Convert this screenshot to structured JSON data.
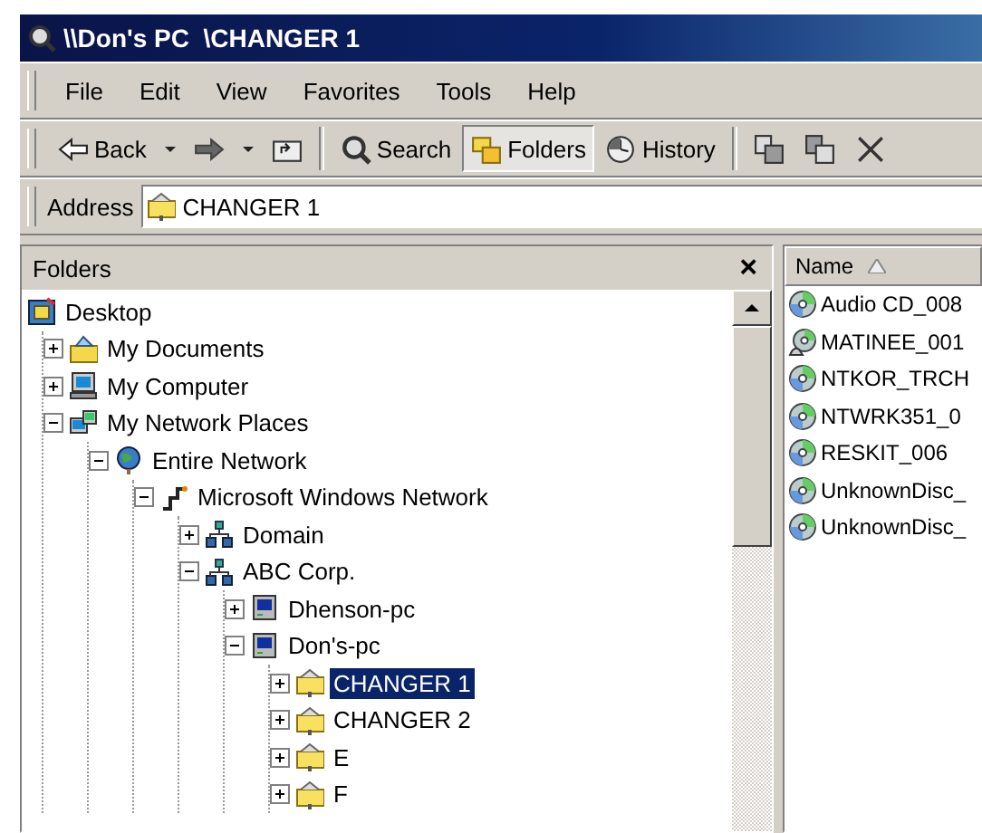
{
  "window": {
    "title": "\\\\Don's PC  \\CHANGER 1"
  },
  "menu": [
    "File",
    "Edit",
    "View",
    "Favorites",
    "Tools",
    "Help"
  ],
  "toolbar": [
    {
      "kind": "back",
      "label": "Back"
    },
    {
      "kind": "forward"
    },
    {
      "kind": "up"
    },
    {
      "kind": "separator"
    },
    {
      "kind": "search",
      "label": "Search",
      "selected": false
    },
    {
      "kind": "folders",
      "label": "Folders",
      "selected": true
    },
    {
      "kind": "history",
      "label": "History",
      "selected": false
    },
    {
      "kind": "separator"
    },
    {
      "kind": "move"
    },
    {
      "kind": "copy"
    },
    {
      "kind": "delete"
    }
  ],
  "address": {
    "label": "Address",
    "value": "CHANGER 1"
  },
  "folders_pane": {
    "title": "Folders",
    "close": "×",
    "tree": [
      {
        "label": "Desktop",
        "kind": "desktop",
        "selected": false,
        "children": [
          {
            "label": "My Documents",
            "kind": "documents",
            "expanded": false,
            "selected": false
          },
          {
            "label": "My Computer",
            "kind": "computer",
            "expanded": false,
            "selected": false
          },
          {
            "label": "My Network Places",
            "kind": "network-places",
            "expanded": true,
            "selected": false,
            "children": [
              {
                "label": "Entire Network",
                "kind": "globe",
                "expanded": true,
                "selected": false,
                "children": [
                  {
                    "label": "Microsoft Windows Network",
                    "kind": "network",
                    "expanded": true,
                    "selected": false,
                    "children": [
                      {
                        "label": "Domain",
                        "kind": "domain",
                        "expanded": false,
                        "selected": false
                      },
                      {
                        "label": "ABC Corp.",
                        "kind": "domain",
                        "expanded": true,
                        "selected": false,
                        "children": [
                          {
                            "label": "Dhenson-pc",
                            "kind": "pc",
                            "expanded": false,
                            "selected": false
                          },
                          {
                            "label": "Don's-pc",
                            "kind": "pc",
                            "expanded": true,
                            "selected": false,
                            "children": [
                              {
                                "label": "CHANGER 1",
                                "kind": "share",
                                "expanded": false,
                                "selected": true
                              },
                              {
                                "label": "CHANGER 2",
                                "kind": "share",
                                "expanded": false,
                                "selected": false
                              },
                              {
                                "label": "E",
                                "kind": "share",
                                "expanded": false,
                                "selected": false
                              },
                              {
                                "label": "F",
                                "kind": "share",
                                "expanded": false,
                                "selected": false
                              }
                            ]
                          }
                        ]
                      }
                    ]
                  }
                ]
              }
            ]
          }
        ]
      }
    ]
  },
  "file_list": {
    "columns": [
      {
        "label": "Name",
        "sorted_ascending": true
      }
    ],
    "items": [
      {
        "name": "Audio CD_008",
        "kind": "disc"
      },
      {
        "name": "MATINEE_001",
        "kind": "shared-disc"
      },
      {
        "name": "NTKOR_TRCH",
        "kind": "disc"
      },
      {
        "name": "NTWRK351_0",
        "kind": "disc"
      },
      {
        "name": "RESKIT_006",
        "kind": "disc"
      },
      {
        "name": "UnknownDisc_",
        "kind": "disc"
      },
      {
        "name": "UnknownDisc_",
        "kind": "disc"
      }
    ]
  }
}
